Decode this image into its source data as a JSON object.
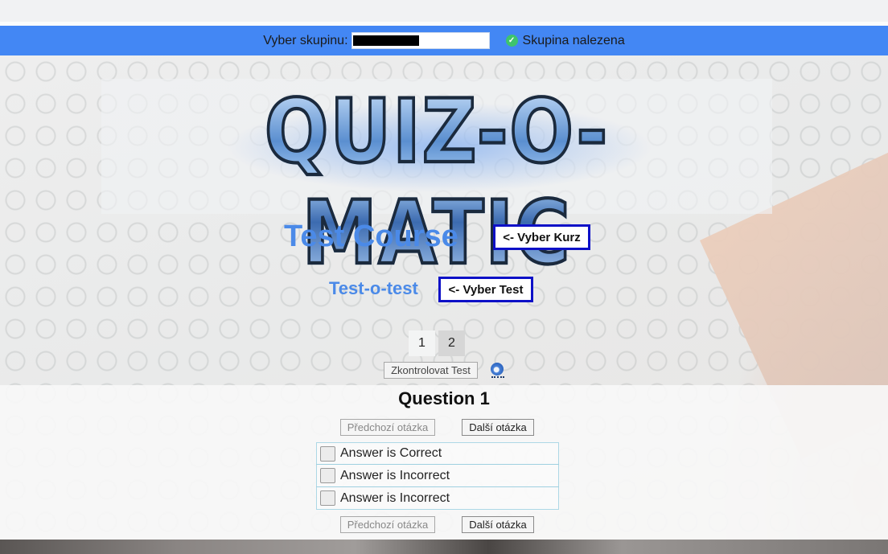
{
  "groupbar": {
    "label": "Vyber skupinu:",
    "input_value": "",
    "input_redacted": true,
    "status_icon": "check-circle-icon",
    "status_text": "Skupina nalezena",
    "bar_color": "#4387f4"
  },
  "header": {
    "logo_text": "QUIZ-O-MATIC"
  },
  "course": {
    "title": "Test Course",
    "select_button": "<- Vyber Kurz"
  },
  "test": {
    "title": "Test-o-test",
    "select_button": "<- Vyber Test"
  },
  "pagination": {
    "pages": [
      "1",
      "2"
    ],
    "active_page": "2"
  },
  "actions": {
    "check_test_button": "Zkontrolovat Test",
    "reload_icon": "reload-icon"
  },
  "question": {
    "title": "Question 1",
    "prev_button": "Předchozí otázka",
    "next_button": "Další otázka",
    "answers": [
      {
        "label": "Answer is Correct",
        "checked": false
      },
      {
        "label": "Answer is Incorrect",
        "checked": false
      },
      {
        "label": "Answer is Incorrect",
        "checked": false
      }
    ]
  },
  "colors": {
    "accent_blue": "#4b8ae8",
    "button_border": "#0d10c7",
    "answer_border": "#add8e6"
  }
}
